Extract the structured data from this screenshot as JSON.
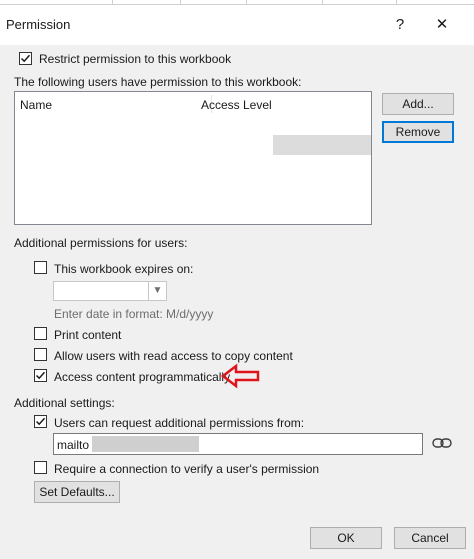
{
  "window": {
    "title": "Permission",
    "help_label": "?",
    "close_label": "✕"
  },
  "restrict": {
    "label": "Restrict permission to this workbook",
    "checked": true
  },
  "users": {
    "caption": "The following users have permission to this workbook:",
    "columns": [
      "Name",
      "Access Level"
    ],
    "add_label": "Add...",
    "remove_label": "Remove"
  },
  "additional_permissions": {
    "heading": "Additional permissions for users:",
    "expires_label": "This workbook expires on:",
    "expires_checked": false,
    "date_value": "",
    "date_hint": "Enter date in format: M/d/yyyy",
    "print_label": "Print content",
    "print_checked": false,
    "copy_label": "Allow users with read access to copy content",
    "copy_checked": false,
    "programmatic_label": "Access content programmatically",
    "programmatic_checked": true
  },
  "additional_settings": {
    "heading": "Additional settings:",
    "request_label": "Users can request additional permissions from:",
    "request_checked": true,
    "request_value": "mailto",
    "verify_label": "Require a connection to verify a user's permission",
    "verify_checked": false,
    "set_defaults_label": "Set Defaults..."
  },
  "footer": {
    "ok_label": "OK",
    "cancel_label": "Cancel"
  },
  "icons": {
    "link": "link-icon",
    "annotation": "red-arrow-annotation"
  },
  "colors": {
    "accent": "#0078d7",
    "annotation": "#e0141c",
    "dialog_bg": "#f0f0f0"
  }
}
